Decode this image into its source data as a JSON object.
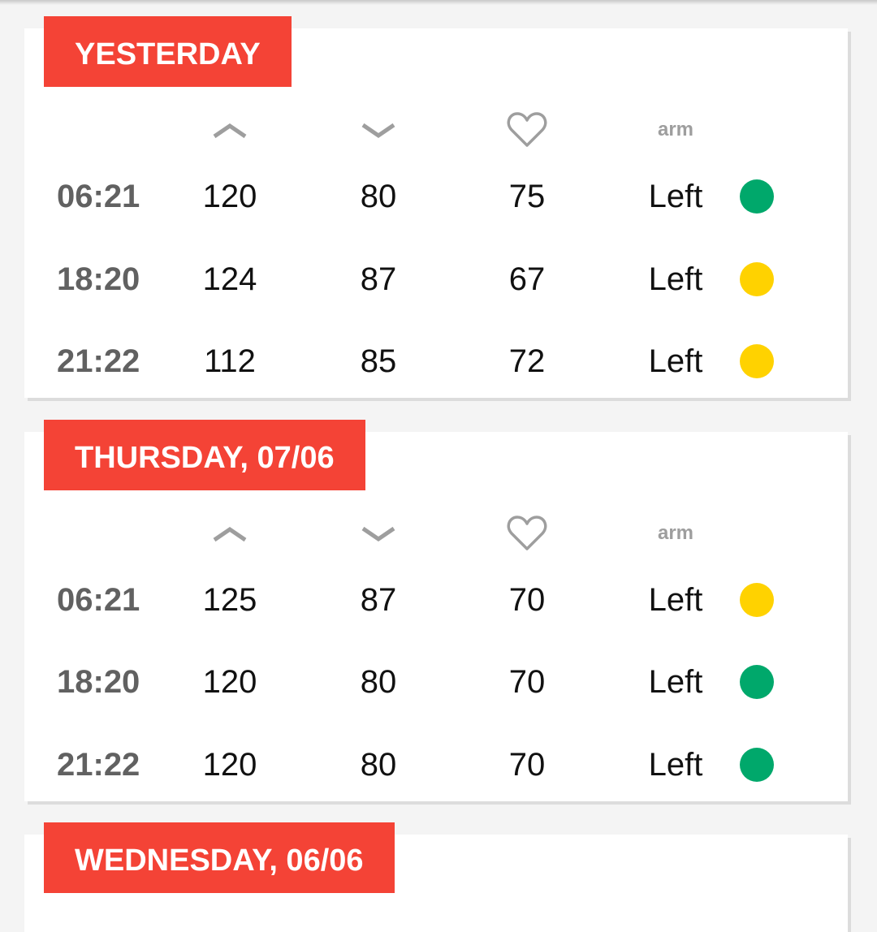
{
  "columns": {
    "systolic_icon": "chevron-up-icon",
    "diastolic_icon": "chevron-down-icon",
    "pulse_icon": "heart-outline-icon",
    "arm_label": "arm"
  },
  "status_colors": {
    "normal": "#00a86b",
    "elevated": "#ffd200"
  },
  "accent_color": "#f44336",
  "days": [
    {
      "label": "YESTERDAY",
      "readings": [
        {
          "time": "06:21",
          "systolic": "120",
          "diastolic": "80",
          "pulse": "75",
          "arm": "Left",
          "status": "normal"
        },
        {
          "time": "18:20",
          "systolic": "124",
          "diastolic": "87",
          "pulse": "67",
          "arm": "Left",
          "status": "elevated"
        },
        {
          "time": "21:22",
          "systolic": "112",
          "diastolic": "85",
          "pulse": "72",
          "arm": "Left",
          "status": "elevated"
        }
      ]
    },
    {
      "label": "THURSDAY, 07/06",
      "readings": [
        {
          "time": "06:21",
          "systolic": "125",
          "diastolic": "87",
          "pulse": "70",
          "arm": "Left",
          "status": "elevated"
        },
        {
          "time": "18:20",
          "systolic": "120",
          "diastolic": "80",
          "pulse": "70",
          "arm": "Left",
          "status": "normal"
        },
        {
          "time": "21:22",
          "systolic": "120",
          "diastolic": "80",
          "pulse": "70",
          "arm": "Left",
          "status": "normal"
        }
      ]
    },
    {
      "label": "WEDNESDAY, 06/06",
      "readings": []
    }
  ]
}
